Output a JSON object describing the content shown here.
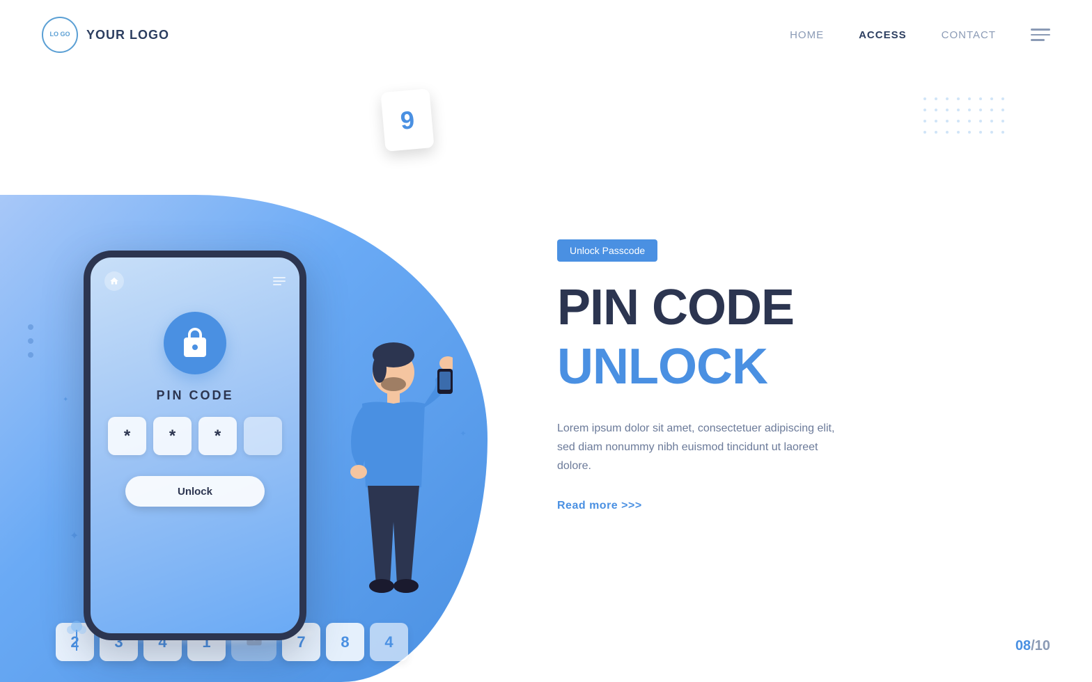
{
  "header": {
    "logo_text": "YOUR LOGO",
    "logo_circle_text": "LO\nGO",
    "nav": {
      "items": [
        {
          "label": "HOME",
          "active": false
        },
        {
          "label": "ACCESS",
          "active": true
        },
        {
          "label": "CONTACT",
          "active": false
        }
      ]
    }
  },
  "hero": {
    "badge": "Unlock Passcode",
    "title_line1": "PIN CODE",
    "title_line2": "UNLOCK",
    "description": "Lorem ipsum dolor sit amet, consectetuer adipiscing elit, sed diam nonummy nibh euismod tincidunt ut laoreet dolore.",
    "read_more": "Read more >>>",
    "phone": {
      "pin_label": "PIN CODE",
      "pin_boxes": [
        "*",
        "*",
        "*",
        ""
      ],
      "unlock_btn": "Unlock"
    },
    "ground_numbers": [
      "2",
      "3",
      "4",
      "1",
      "7",
      "8",
      "4"
    ],
    "number_nine": "9"
  },
  "pagination": {
    "current": "08",
    "separator": "/",
    "total": "10"
  }
}
